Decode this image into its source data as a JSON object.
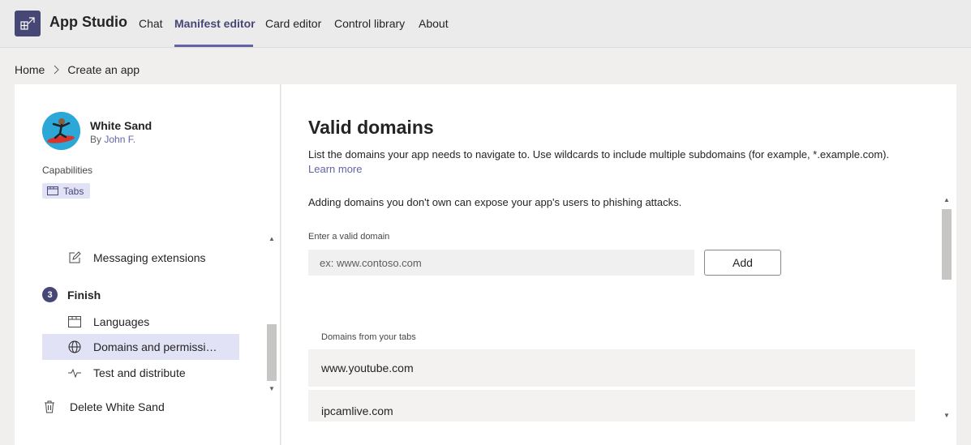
{
  "header": {
    "app_title": "App Studio",
    "tabs": [
      {
        "label": "Chat"
      },
      {
        "label": "Manifest editor"
      },
      {
        "label": "Card editor"
      },
      {
        "label": "Control library"
      },
      {
        "label": "About"
      }
    ],
    "active_tab": "Manifest editor"
  },
  "breadcrumb": {
    "home": "Home",
    "current": "Create an app"
  },
  "app_info": {
    "name": "White Sand",
    "by_prefix": "By",
    "author": "John F.",
    "capabilities_label": "Capabilities",
    "capability_chip": "Tabs"
  },
  "sidebar": {
    "items_before": [
      {
        "label": "Messaging extensions",
        "icon": "edit-icon"
      }
    ],
    "step": {
      "number": "3",
      "label": "Finish"
    },
    "finish_items": [
      {
        "label": "Languages",
        "icon": "window-icon"
      },
      {
        "label": "Domains and permissi…",
        "icon": "globe-icon",
        "selected": true
      },
      {
        "label": "Test and distribute",
        "icon": "pulse-icon"
      }
    ],
    "delete_label": "Delete White Sand"
  },
  "main": {
    "title": "Valid domains",
    "description": "List the domains your app needs to navigate to. Use wildcards to include multiple subdomains (for example, *.example.com).",
    "learn_more": "Learn more",
    "warning": "Adding domains you don't own can expose your app's users to phishing attacks.",
    "input_label": "Enter a valid domain",
    "input_placeholder": "ex: www.contoso.com",
    "input_value": "",
    "add_button": "Add",
    "list_label": "Domains from your tabs",
    "domains": [
      "www.youtube.com",
      "ipcamlive.com"
    ]
  },
  "colors": {
    "accent": "#6264a7",
    "brand_dark": "#464775",
    "selected_bg": "#e2e2f6"
  }
}
